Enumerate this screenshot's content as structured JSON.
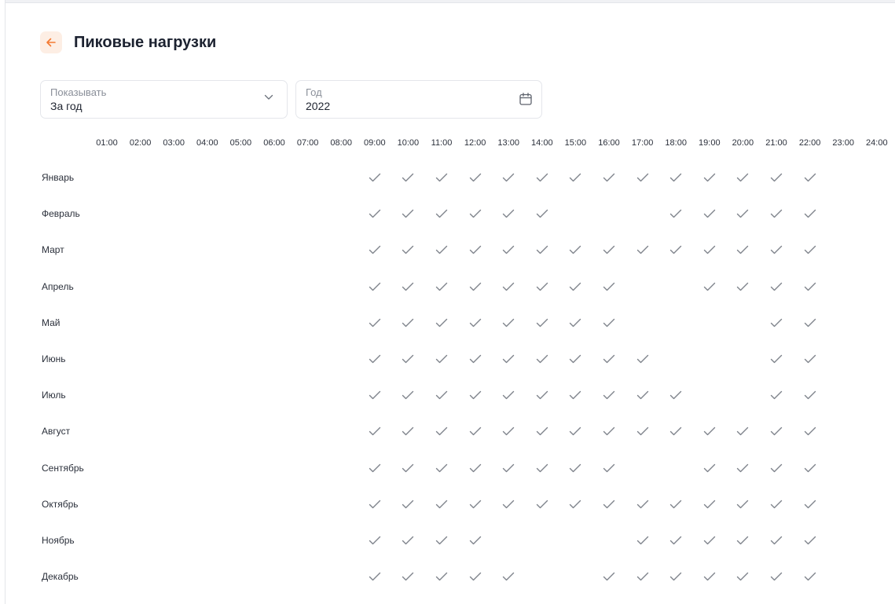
{
  "page": {
    "title": "Пиковые нагрузки"
  },
  "filters": {
    "show": {
      "label": "Показывать",
      "value": "За год"
    },
    "year": {
      "label": "Год",
      "value": "2022"
    }
  },
  "hours": [
    "01:00",
    "02:00",
    "03:00",
    "04:00",
    "05:00",
    "06:00",
    "07:00",
    "08:00",
    "09:00",
    "10:00",
    "11:00",
    "12:00",
    "13:00",
    "14:00",
    "15:00",
    "16:00",
    "17:00",
    "18:00",
    "19:00",
    "20:00",
    "21:00",
    "22:00",
    "23:00",
    "24:00"
  ],
  "months": [
    {
      "name": "Январь",
      "peak_hours": [
        "09:00",
        "10:00",
        "11:00",
        "12:00",
        "13:00",
        "14:00",
        "15:00",
        "16:00",
        "17:00",
        "18:00",
        "19:00",
        "20:00",
        "21:00",
        "22:00"
      ]
    },
    {
      "name": "Февраль",
      "peak_hours": [
        "09:00",
        "10:00",
        "11:00",
        "12:00",
        "13:00",
        "14:00",
        "18:00",
        "19:00",
        "20:00",
        "21:00",
        "22:00"
      ]
    },
    {
      "name": "Март",
      "peak_hours": [
        "09:00",
        "10:00",
        "11:00",
        "12:00",
        "13:00",
        "14:00",
        "15:00",
        "16:00",
        "17:00",
        "18:00",
        "19:00",
        "20:00",
        "21:00",
        "22:00"
      ]
    },
    {
      "name": "Апрель",
      "peak_hours": [
        "09:00",
        "10:00",
        "11:00",
        "12:00",
        "13:00",
        "14:00",
        "15:00",
        "16:00",
        "19:00",
        "20:00",
        "21:00",
        "22:00"
      ]
    },
    {
      "name": "Май",
      "peak_hours": [
        "09:00",
        "10:00",
        "11:00",
        "12:00",
        "13:00",
        "14:00",
        "15:00",
        "16:00",
        "21:00",
        "22:00"
      ]
    },
    {
      "name": "Июнь",
      "peak_hours": [
        "09:00",
        "10:00",
        "11:00",
        "12:00",
        "13:00",
        "14:00",
        "15:00",
        "16:00",
        "17:00",
        "21:00",
        "22:00"
      ]
    },
    {
      "name": "Июль",
      "peak_hours": [
        "09:00",
        "10:00",
        "11:00",
        "12:00",
        "13:00",
        "14:00",
        "15:00",
        "16:00",
        "17:00",
        "18:00",
        "21:00",
        "22:00"
      ]
    },
    {
      "name": "Август",
      "peak_hours": [
        "09:00",
        "10:00",
        "11:00",
        "12:00",
        "13:00",
        "14:00",
        "15:00",
        "16:00",
        "17:00",
        "18:00",
        "19:00",
        "20:00",
        "21:00",
        "22:00"
      ]
    },
    {
      "name": "Сентябрь",
      "peak_hours": [
        "09:00",
        "10:00",
        "11:00",
        "12:00",
        "13:00",
        "14:00",
        "15:00",
        "16:00",
        "19:00",
        "20:00",
        "21:00",
        "22:00"
      ]
    },
    {
      "name": "Октябрь",
      "peak_hours": [
        "09:00",
        "10:00",
        "11:00",
        "12:00",
        "13:00",
        "14:00",
        "15:00",
        "16:00",
        "17:00",
        "18:00",
        "19:00",
        "20:00",
        "21:00",
        "22:00"
      ]
    },
    {
      "name": "Ноябрь",
      "peak_hours": [
        "09:00",
        "10:00",
        "11:00",
        "12:00",
        "17:00",
        "18:00",
        "19:00",
        "20:00",
        "21:00",
        "22:00"
      ]
    },
    {
      "name": "Декабрь",
      "peak_hours": [
        "09:00",
        "10:00",
        "11:00",
        "12:00",
        "13:00",
        "16:00",
        "17:00",
        "18:00",
        "19:00",
        "20:00",
        "21:00",
        "22:00"
      ]
    }
  ],
  "icons": {
    "back": "arrow-left-icon",
    "dropdown": "chevron-down-icon",
    "calendar": "calendar-icon",
    "check": "check-icon"
  },
  "colors": {
    "accent": "#f47a32",
    "accent_bg": "#fdeee4",
    "check": "#7f848c"
  }
}
